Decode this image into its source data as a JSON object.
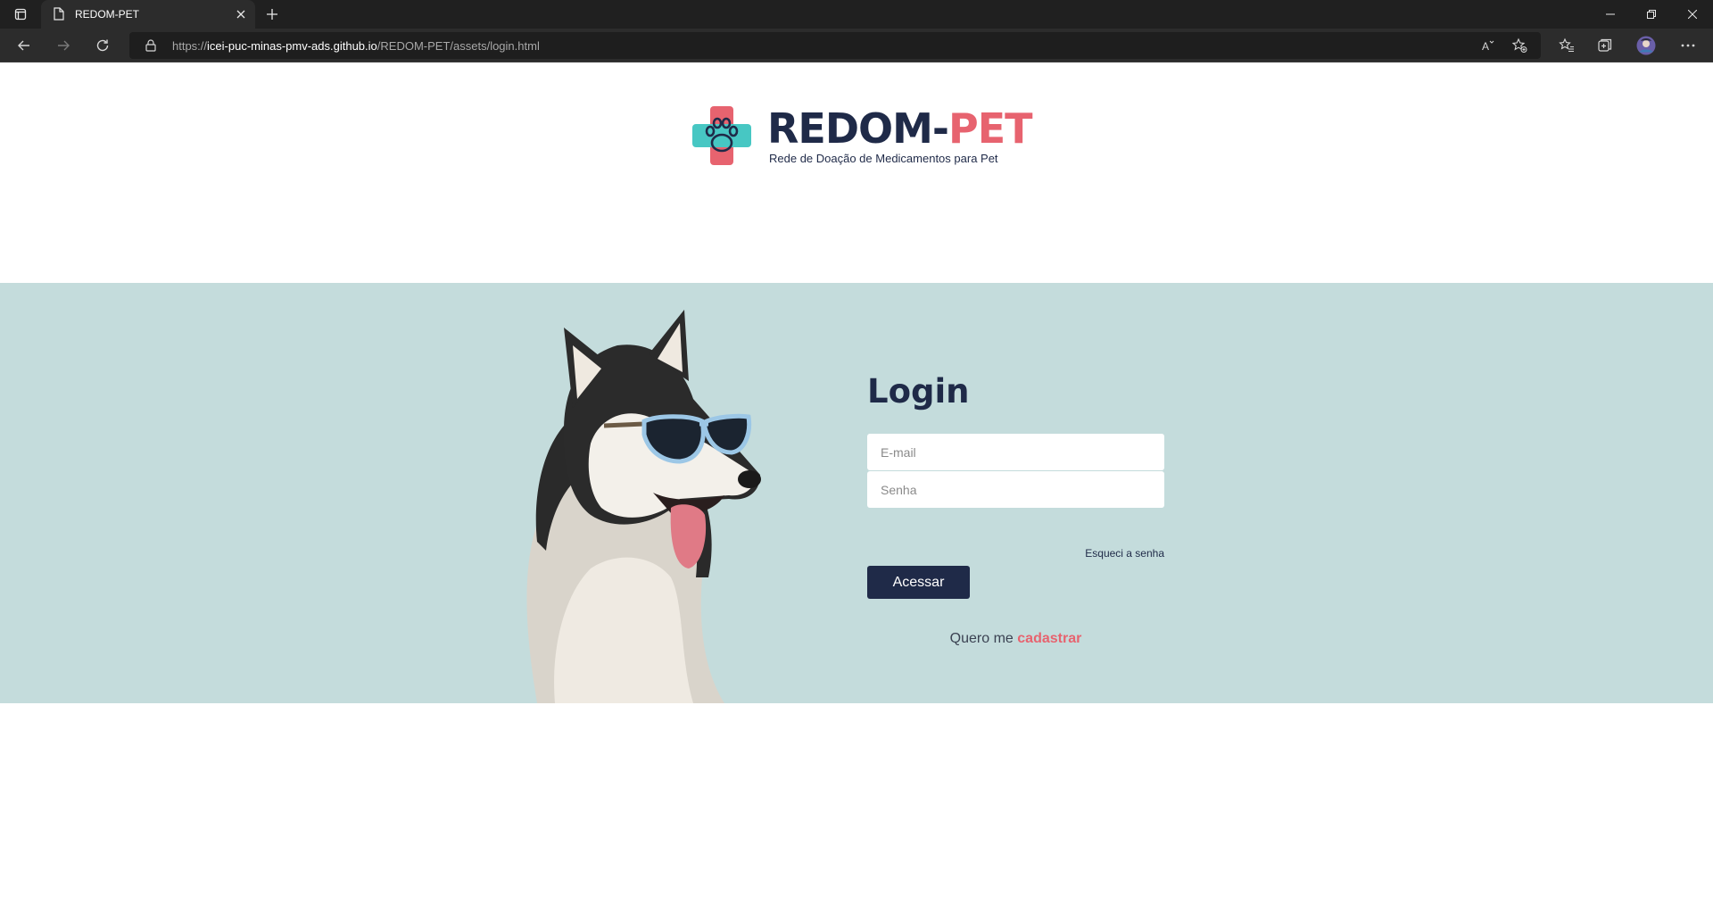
{
  "browser": {
    "tab_title": "REDOM-PET",
    "url_scheme": "https://",
    "url_host": "icei-puc-minas-pmv-ads.github.io",
    "url_path": "/REDOM-PET/assets/login.html",
    "icons": [
      "tab-actions-icon",
      "page-icon",
      "close-icon",
      "new-tab-icon",
      "minimize-icon",
      "restore-icon",
      "window-close-icon",
      "back-icon",
      "forward-icon",
      "refresh-icon",
      "lock-icon",
      "read-aloud-icon",
      "add-favorite-icon",
      "favorites-icon",
      "collections-icon",
      "profile-avatar",
      "more-icon"
    ]
  },
  "logo": {
    "brand_main": "REDOM-",
    "brand_accent": "PET",
    "tagline": "Rede de Doação de Medicamentos para Pet"
  },
  "login": {
    "title": "Login",
    "email_placeholder": "E-mail",
    "password_placeholder": "Senha",
    "forgot_password": "Esqueci a senha",
    "submit_label": "Acessar",
    "signup_prefix": "Quero me",
    "signup_link": "cadastrar"
  },
  "colors": {
    "navy": "#1f2a48",
    "coral": "#e7636f",
    "hero_bg": "#c4dcdc",
    "teal": "#47c7c3"
  }
}
